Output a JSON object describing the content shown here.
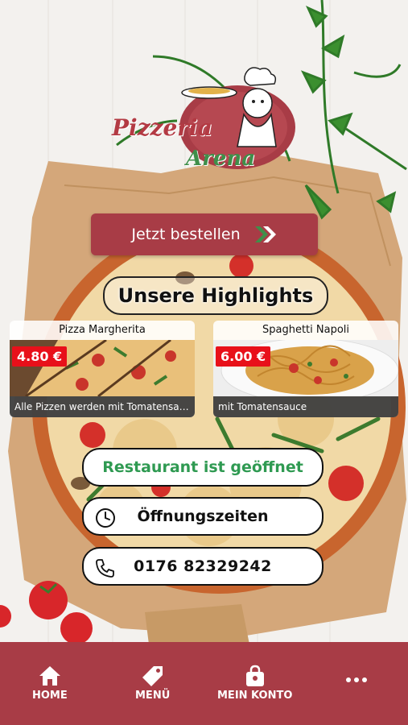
{
  "logo": {
    "line1": "Pizzeria",
    "line2": "Arena"
  },
  "order_button": {
    "label": "Jetzt bestellen"
  },
  "highlights": {
    "title": "Unsere Highlights",
    "items": [
      {
        "name": "Pizza Margherita",
        "price": "4.80 €",
        "description": "Alle Pizzen werden mit Tomatensauce, K..."
      },
      {
        "name": "Spaghetti Napoli",
        "price": "6.00 €",
        "description": "mit Tomatensauce"
      }
    ]
  },
  "status": {
    "label": "Restaurant ist geöffnet"
  },
  "opening_hours": {
    "label": "Öffnungszeiten"
  },
  "phone": {
    "number": "0176 82329242"
  },
  "tabbar": {
    "items": [
      {
        "label": "HOME",
        "icon": "home-icon"
      },
      {
        "label": "MENÜ",
        "icon": "tag-icon"
      },
      {
        "label": "MEIN KONTO",
        "icon": "bag-icon"
      },
      {
        "label": "",
        "icon": "more-icon"
      }
    ]
  },
  "colors": {
    "brand": "#a83c46",
    "open_green": "#2f9a52",
    "price_red": "#e8101a"
  }
}
